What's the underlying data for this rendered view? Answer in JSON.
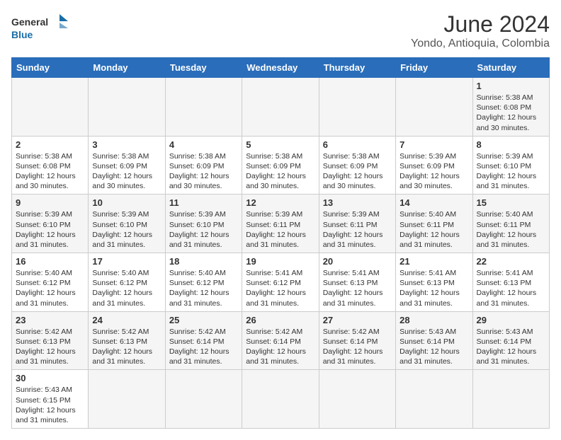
{
  "header": {
    "logo_general": "General",
    "logo_blue": "Blue",
    "title": "June 2024",
    "subtitle": "Yondo, Antioquia, Colombia"
  },
  "weekdays": [
    "Sunday",
    "Monday",
    "Tuesday",
    "Wednesday",
    "Thursday",
    "Friday",
    "Saturday"
  ],
  "weeks": [
    [
      {
        "day": "",
        "info": ""
      },
      {
        "day": "",
        "info": ""
      },
      {
        "day": "",
        "info": ""
      },
      {
        "day": "",
        "info": ""
      },
      {
        "day": "",
        "info": ""
      },
      {
        "day": "",
        "info": ""
      },
      {
        "day": "1",
        "info": "Sunrise: 5:38 AM\nSunset: 6:08 PM\nDaylight: 12 hours and 30 minutes."
      }
    ],
    [
      {
        "day": "2",
        "info": "Sunrise: 5:38 AM\nSunset: 6:08 PM\nDaylight: 12 hours and 30 minutes."
      },
      {
        "day": "3",
        "info": "Sunrise: 5:38 AM\nSunset: 6:09 PM\nDaylight: 12 hours and 30 minutes."
      },
      {
        "day": "4",
        "info": "Sunrise: 5:38 AM\nSunset: 6:09 PM\nDaylight: 12 hours and 30 minutes."
      },
      {
        "day": "5",
        "info": "Sunrise: 5:38 AM\nSunset: 6:09 PM\nDaylight: 12 hours and 30 minutes."
      },
      {
        "day": "6",
        "info": "Sunrise: 5:38 AM\nSunset: 6:09 PM\nDaylight: 12 hours and 30 minutes."
      },
      {
        "day": "7",
        "info": "Sunrise: 5:39 AM\nSunset: 6:09 PM\nDaylight: 12 hours and 30 minutes."
      },
      {
        "day": "8",
        "info": "Sunrise: 5:39 AM\nSunset: 6:10 PM\nDaylight: 12 hours and 31 minutes."
      }
    ],
    [
      {
        "day": "9",
        "info": "Sunrise: 5:39 AM\nSunset: 6:10 PM\nDaylight: 12 hours and 31 minutes."
      },
      {
        "day": "10",
        "info": "Sunrise: 5:39 AM\nSunset: 6:10 PM\nDaylight: 12 hours and 31 minutes."
      },
      {
        "day": "11",
        "info": "Sunrise: 5:39 AM\nSunset: 6:10 PM\nDaylight: 12 hours and 31 minutes."
      },
      {
        "day": "12",
        "info": "Sunrise: 5:39 AM\nSunset: 6:11 PM\nDaylight: 12 hours and 31 minutes."
      },
      {
        "day": "13",
        "info": "Sunrise: 5:39 AM\nSunset: 6:11 PM\nDaylight: 12 hours and 31 minutes."
      },
      {
        "day": "14",
        "info": "Sunrise: 5:40 AM\nSunset: 6:11 PM\nDaylight: 12 hours and 31 minutes."
      },
      {
        "day": "15",
        "info": "Sunrise: 5:40 AM\nSunset: 6:11 PM\nDaylight: 12 hours and 31 minutes."
      }
    ],
    [
      {
        "day": "16",
        "info": "Sunrise: 5:40 AM\nSunset: 6:12 PM\nDaylight: 12 hours and 31 minutes."
      },
      {
        "day": "17",
        "info": "Sunrise: 5:40 AM\nSunset: 6:12 PM\nDaylight: 12 hours and 31 minutes."
      },
      {
        "day": "18",
        "info": "Sunrise: 5:40 AM\nSunset: 6:12 PM\nDaylight: 12 hours and 31 minutes."
      },
      {
        "day": "19",
        "info": "Sunrise: 5:41 AM\nSunset: 6:12 PM\nDaylight: 12 hours and 31 minutes."
      },
      {
        "day": "20",
        "info": "Sunrise: 5:41 AM\nSunset: 6:13 PM\nDaylight: 12 hours and 31 minutes."
      },
      {
        "day": "21",
        "info": "Sunrise: 5:41 AM\nSunset: 6:13 PM\nDaylight: 12 hours and 31 minutes."
      },
      {
        "day": "22",
        "info": "Sunrise: 5:41 AM\nSunset: 6:13 PM\nDaylight: 12 hours and 31 minutes."
      }
    ],
    [
      {
        "day": "23",
        "info": "Sunrise: 5:42 AM\nSunset: 6:13 PM\nDaylight: 12 hours and 31 minutes."
      },
      {
        "day": "24",
        "info": "Sunrise: 5:42 AM\nSunset: 6:13 PM\nDaylight: 12 hours and 31 minutes."
      },
      {
        "day": "25",
        "info": "Sunrise: 5:42 AM\nSunset: 6:14 PM\nDaylight: 12 hours and 31 minutes."
      },
      {
        "day": "26",
        "info": "Sunrise: 5:42 AM\nSunset: 6:14 PM\nDaylight: 12 hours and 31 minutes."
      },
      {
        "day": "27",
        "info": "Sunrise: 5:42 AM\nSunset: 6:14 PM\nDaylight: 12 hours and 31 minutes."
      },
      {
        "day": "28",
        "info": "Sunrise: 5:43 AM\nSunset: 6:14 PM\nDaylight: 12 hours and 31 minutes."
      },
      {
        "day": "29",
        "info": "Sunrise: 5:43 AM\nSunset: 6:14 PM\nDaylight: 12 hours and 31 minutes."
      }
    ],
    [
      {
        "day": "30",
        "info": "Sunrise: 5:43 AM\nSunset: 6:15 PM\nDaylight: 12 hours and 31 minutes."
      },
      {
        "day": "",
        "info": ""
      },
      {
        "day": "",
        "info": ""
      },
      {
        "day": "",
        "info": ""
      },
      {
        "day": "",
        "info": ""
      },
      {
        "day": "",
        "info": ""
      },
      {
        "day": "",
        "info": ""
      }
    ]
  ]
}
